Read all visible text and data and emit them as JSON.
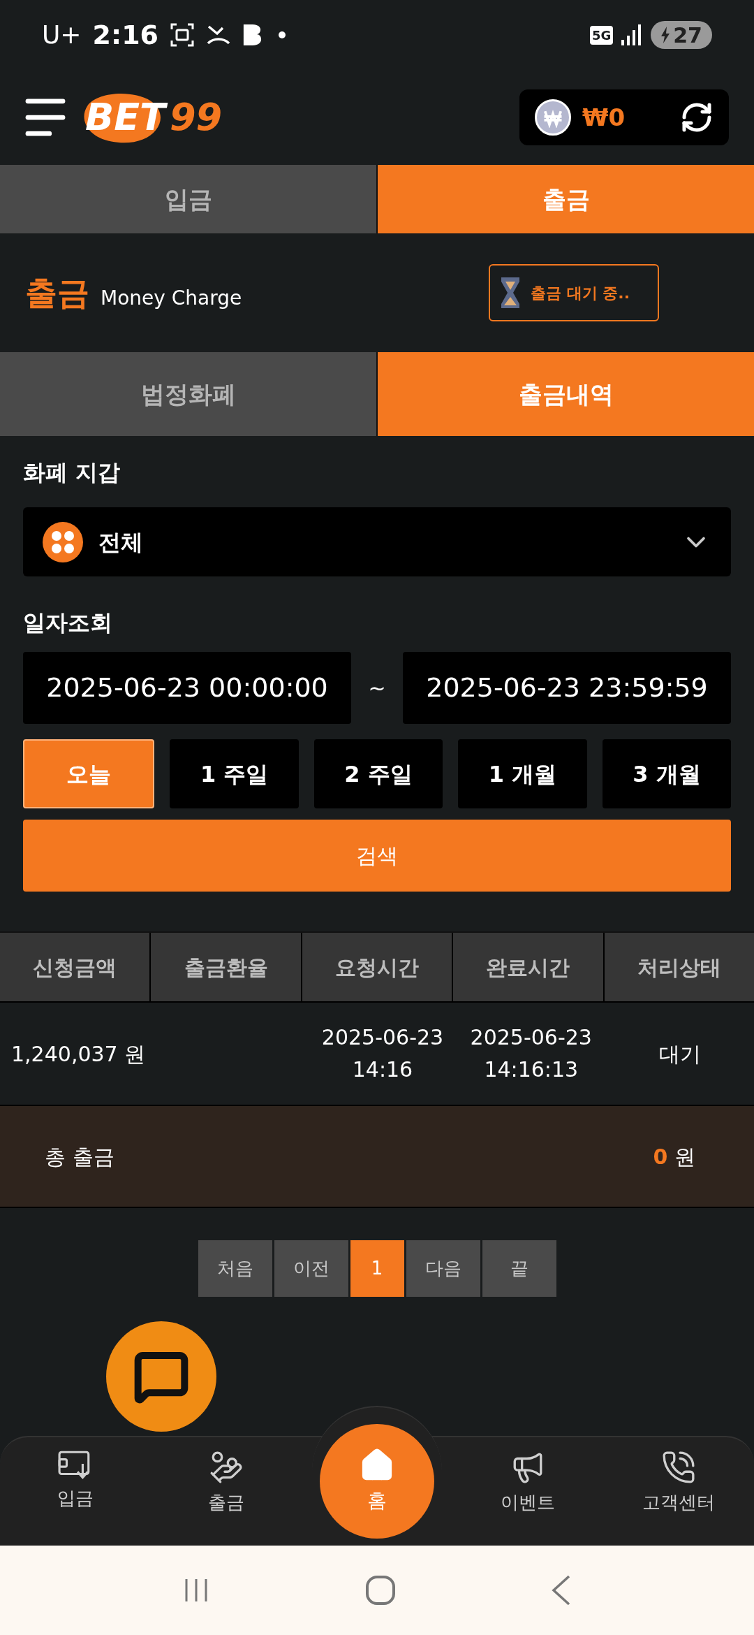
{
  "status_bar": {
    "carrier": "U+",
    "time": "2:16",
    "network": "5G",
    "battery": "27"
  },
  "header": {
    "logo_main": "BET",
    "logo_number": "99",
    "balance": "₩0"
  },
  "top_tabs": [
    {
      "label": "입금",
      "selected": false
    },
    {
      "label": "출금",
      "selected": true
    }
  ],
  "title": {
    "main": "출금",
    "subtitle": "Money Charge",
    "pending_button": "출금 대기 중.."
  },
  "sub_tabs": [
    {
      "label": "법정화폐",
      "selected": false
    },
    {
      "label": "출금내역",
      "selected": true
    }
  ],
  "wallet": {
    "label": "화폐 지갑",
    "value": "전체"
  },
  "date_query": {
    "label": "일자조회",
    "from": "2025-06-23 00:00:00",
    "separator": "~",
    "to": "2025-06-23 23:59:59"
  },
  "periods": [
    {
      "label": "오늘",
      "selected": true
    },
    {
      "label": "1 주일",
      "selected": false
    },
    {
      "label": "2 주일",
      "selected": false
    },
    {
      "label": "1 개월",
      "selected": false
    },
    {
      "label": "3 개월",
      "selected": false
    }
  ],
  "search_button": "검색",
  "table": {
    "columns": [
      "신청금액",
      "출금환율",
      "요청시간",
      "완료시간",
      "처리상태"
    ],
    "rows": [
      {
        "amount": "1,240,037 원",
        "request_time": [
          "2025-06-23",
          "14:16"
        ],
        "completed_time": [
          "2025-06-23",
          "14:16:13"
        ],
        "status": "대기"
      }
    ]
  },
  "total": {
    "label": "총 출금",
    "value": "0",
    "unit": "원"
  },
  "pagination": [
    {
      "label": "처음",
      "selected": false
    },
    {
      "label": "이전",
      "selected": false
    },
    {
      "label": "1",
      "selected": true
    },
    {
      "label": "다음",
      "selected": false
    },
    {
      "label": "끝",
      "selected": false
    }
  ],
  "bottom_nav": [
    {
      "label": "입금",
      "selected": false
    },
    {
      "label": "출금",
      "selected": false
    },
    {
      "label": "홈",
      "selected": true
    },
    {
      "label": "이벤트",
      "selected": false
    },
    {
      "label": "고객센터",
      "selected": false
    }
  ]
}
